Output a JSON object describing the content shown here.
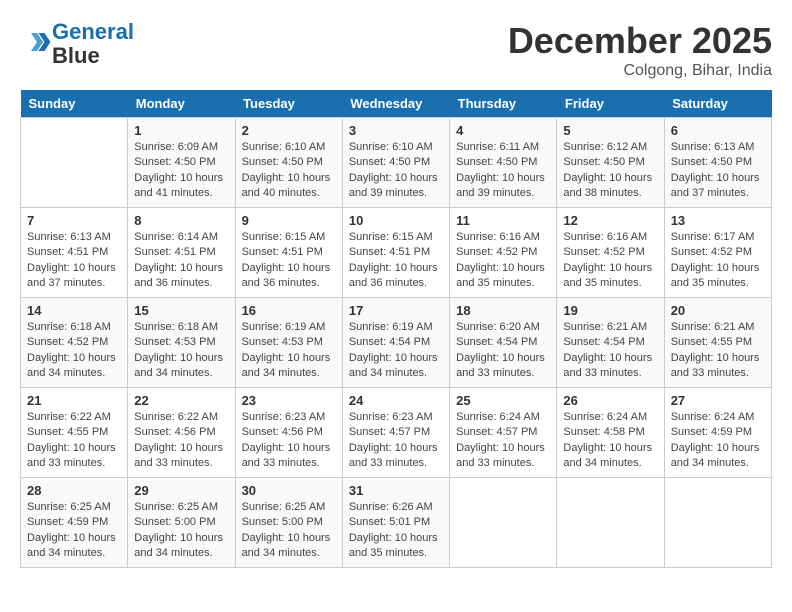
{
  "header": {
    "logo_line1": "General",
    "logo_line2": "Blue",
    "month": "December 2025",
    "location": "Colgong, Bihar, India"
  },
  "weekdays": [
    "Sunday",
    "Monday",
    "Tuesday",
    "Wednesday",
    "Thursday",
    "Friday",
    "Saturday"
  ],
  "weeks": [
    [
      {
        "day": "",
        "sunrise": "",
        "sunset": "",
        "daylight": ""
      },
      {
        "day": "1",
        "sunrise": "6:09 AM",
        "sunset": "4:50 PM",
        "daylight": "10 hours and 41 minutes."
      },
      {
        "day": "2",
        "sunrise": "6:10 AM",
        "sunset": "4:50 PM",
        "daylight": "10 hours and 40 minutes."
      },
      {
        "day": "3",
        "sunrise": "6:10 AM",
        "sunset": "4:50 PM",
        "daylight": "10 hours and 39 minutes."
      },
      {
        "day": "4",
        "sunrise": "6:11 AM",
        "sunset": "4:50 PM",
        "daylight": "10 hours and 39 minutes."
      },
      {
        "day": "5",
        "sunrise": "6:12 AM",
        "sunset": "4:50 PM",
        "daylight": "10 hours and 38 minutes."
      },
      {
        "day": "6",
        "sunrise": "6:13 AM",
        "sunset": "4:50 PM",
        "daylight": "10 hours and 37 minutes."
      }
    ],
    [
      {
        "day": "7",
        "sunrise": "6:13 AM",
        "sunset": "4:51 PM",
        "daylight": "10 hours and 37 minutes."
      },
      {
        "day": "8",
        "sunrise": "6:14 AM",
        "sunset": "4:51 PM",
        "daylight": "10 hours and 36 minutes."
      },
      {
        "day": "9",
        "sunrise": "6:15 AM",
        "sunset": "4:51 PM",
        "daylight": "10 hours and 36 minutes."
      },
      {
        "day": "10",
        "sunrise": "6:15 AM",
        "sunset": "4:51 PM",
        "daylight": "10 hours and 36 minutes."
      },
      {
        "day": "11",
        "sunrise": "6:16 AM",
        "sunset": "4:52 PM",
        "daylight": "10 hours and 35 minutes."
      },
      {
        "day": "12",
        "sunrise": "6:16 AM",
        "sunset": "4:52 PM",
        "daylight": "10 hours and 35 minutes."
      },
      {
        "day": "13",
        "sunrise": "6:17 AM",
        "sunset": "4:52 PM",
        "daylight": "10 hours and 35 minutes."
      }
    ],
    [
      {
        "day": "14",
        "sunrise": "6:18 AM",
        "sunset": "4:52 PM",
        "daylight": "10 hours and 34 minutes."
      },
      {
        "day": "15",
        "sunrise": "6:18 AM",
        "sunset": "4:53 PM",
        "daylight": "10 hours and 34 minutes."
      },
      {
        "day": "16",
        "sunrise": "6:19 AM",
        "sunset": "4:53 PM",
        "daylight": "10 hours and 34 minutes."
      },
      {
        "day": "17",
        "sunrise": "6:19 AM",
        "sunset": "4:54 PM",
        "daylight": "10 hours and 34 minutes."
      },
      {
        "day": "18",
        "sunrise": "6:20 AM",
        "sunset": "4:54 PM",
        "daylight": "10 hours and 33 minutes."
      },
      {
        "day": "19",
        "sunrise": "6:21 AM",
        "sunset": "4:54 PM",
        "daylight": "10 hours and 33 minutes."
      },
      {
        "day": "20",
        "sunrise": "6:21 AM",
        "sunset": "4:55 PM",
        "daylight": "10 hours and 33 minutes."
      }
    ],
    [
      {
        "day": "21",
        "sunrise": "6:22 AM",
        "sunset": "4:55 PM",
        "daylight": "10 hours and 33 minutes."
      },
      {
        "day": "22",
        "sunrise": "6:22 AM",
        "sunset": "4:56 PM",
        "daylight": "10 hours and 33 minutes."
      },
      {
        "day": "23",
        "sunrise": "6:23 AM",
        "sunset": "4:56 PM",
        "daylight": "10 hours and 33 minutes."
      },
      {
        "day": "24",
        "sunrise": "6:23 AM",
        "sunset": "4:57 PM",
        "daylight": "10 hours and 33 minutes."
      },
      {
        "day": "25",
        "sunrise": "6:24 AM",
        "sunset": "4:57 PM",
        "daylight": "10 hours and 33 minutes."
      },
      {
        "day": "26",
        "sunrise": "6:24 AM",
        "sunset": "4:58 PM",
        "daylight": "10 hours and 34 minutes."
      },
      {
        "day": "27",
        "sunrise": "6:24 AM",
        "sunset": "4:59 PM",
        "daylight": "10 hours and 34 minutes."
      }
    ],
    [
      {
        "day": "28",
        "sunrise": "6:25 AM",
        "sunset": "4:59 PM",
        "daylight": "10 hours and 34 minutes."
      },
      {
        "day": "29",
        "sunrise": "6:25 AM",
        "sunset": "5:00 PM",
        "daylight": "10 hours and 34 minutes."
      },
      {
        "day": "30",
        "sunrise": "6:25 AM",
        "sunset": "5:00 PM",
        "daylight": "10 hours and 34 minutes."
      },
      {
        "day": "31",
        "sunrise": "6:26 AM",
        "sunset": "5:01 PM",
        "daylight": "10 hours and 35 minutes."
      },
      {
        "day": "",
        "sunrise": "",
        "sunset": "",
        "daylight": ""
      },
      {
        "day": "",
        "sunrise": "",
        "sunset": "",
        "daylight": ""
      },
      {
        "day": "",
        "sunrise": "",
        "sunset": "",
        "daylight": ""
      }
    ]
  ]
}
